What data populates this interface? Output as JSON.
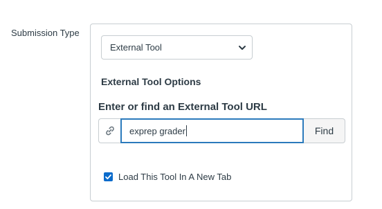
{
  "submission_type": {
    "label": "Submission Type",
    "selected_value": "External Tool"
  },
  "external_tool": {
    "options_heading": "External Tool Options",
    "url_heading": "Enter or find an External Tool URL",
    "url_value": "exprep grader",
    "find_label": "Find",
    "new_tab_label": "Load This Tool In A New Tab",
    "new_tab_checked": true
  },
  "icons": {
    "select": "chevron-down-icon",
    "link": "link-icon",
    "checkbox": "checkmark-icon"
  },
  "colors": {
    "text": "#2d3b45",
    "border": "#c7cdd1",
    "focus_border": "#2b7abc",
    "checkbox": "#0b6bcb",
    "button_bg": "#f5f5f5"
  }
}
